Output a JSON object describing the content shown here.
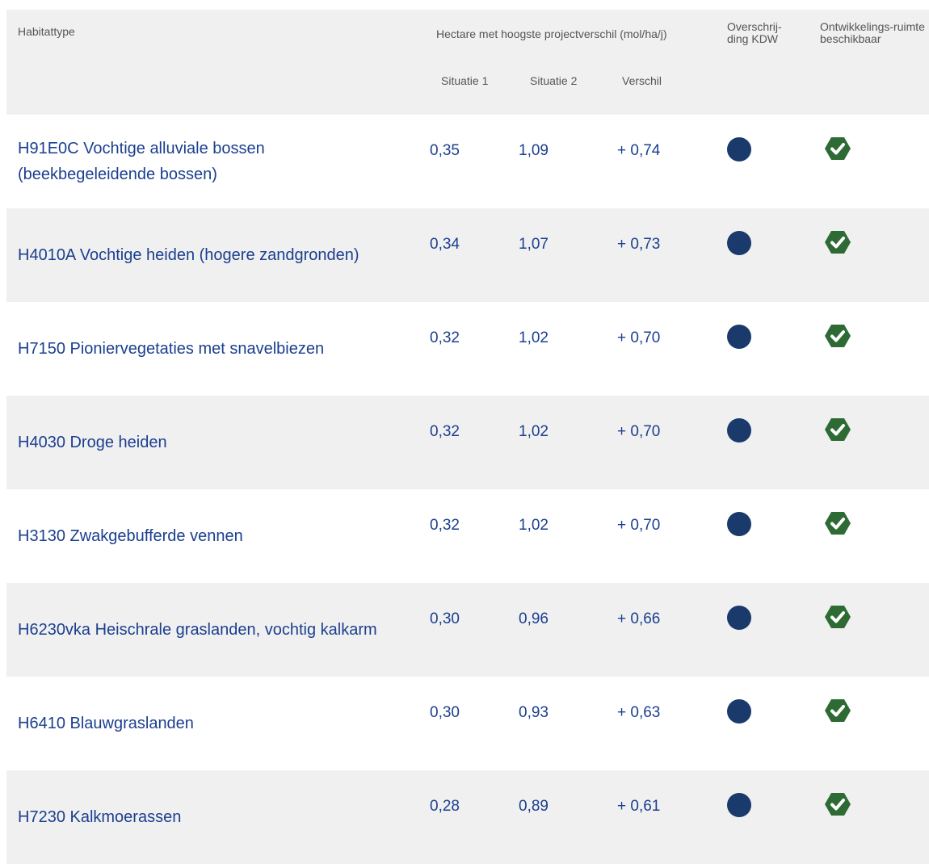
{
  "header": {
    "habitat": "Habitattype",
    "hectare": "Hectare met hoogste projectverschil (mol/ha/j)",
    "situatie1": "Situatie 1",
    "situatie2": "Situatie 2",
    "verschil": "Verschil",
    "overschrijding": "Overschrij-ding KDW",
    "ontwikkeling": "Ontwikkelings-ruimte beschikbaar"
  },
  "colors": {
    "accent": "#1b3f8f",
    "dot": "#1a3a6b",
    "check": "#2e6b34",
    "header_bg": "#f0f0f0"
  },
  "rows": [
    {
      "name": "H91E0C Vochtige alluviale bossen (beekbegeleidende bossen)",
      "s1": "0,35",
      "s2": "1,09",
      "diff": "+ 0,74",
      "overschrijding_icon": "filled-dot-icon",
      "ontwikkeling_icon": "check-badge-icon"
    },
    {
      "name": "H4010A Vochtige heiden (hogere zandgronden)",
      "s1": "0,34",
      "s2": "1,07",
      "diff": "+ 0,73",
      "overschrijding_icon": "filled-dot-icon",
      "ontwikkeling_icon": "check-badge-icon"
    },
    {
      "name": "H7150 Pioniervegetaties met snavelbiezen",
      "s1": "0,32",
      "s2": "1,02",
      "diff": "+ 0,70",
      "overschrijding_icon": "filled-dot-icon",
      "ontwikkeling_icon": "check-badge-icon"
    },
    {
      "name": "H4030 Droge heiden",
      "s1": "0,32",
      "s2": "1,02",
      "diff": "+ 0,70",
      "overschrijding_icon": "filled-dot-icon",
      "ontwikkeling_icon": "check-badge-icon"
    },
    {
      "name": "H3130 Zwakgebufferde vennen",
      "s1": "0,32",
      "s2": "1,02",
      "diff": "+ 0,70",
      "overschrijding_icon": "filled-dot-icon",
      "ontwikkeling_icon": "check-badge-icon"
    },
    {
      "name": "H6230vka Heischrale graslanden, vochtig kalkarm",
      "s1": "0,30",
      "s2": "0,96",
      "diff": "+ 0,66",
      "overschrijding_icon": "filled-dot-icon",
      "ontwikkeling_icon": "check-badge-icon"
    },
    {
      "name": "H6410 Blauwgraslanden",
      "s1": "0,30",
      "s2": "0,93",
      "diff": "+ 0,63",
      "overschrijding_icon": "filled-dot-icon",
      "ontwikkeling_icon": "check-badge-icon"
    },
    {
      "name": "H7230 Kalkmoerassen",
      "s1": "0,28",
      "s2": "0,89",
      "diff": "+ 0,61",
      "overschrijding_icon": "filled-dot-icon",
      "ontwikkeling_icon": "check-badge-icon"
    }
  ]
}
